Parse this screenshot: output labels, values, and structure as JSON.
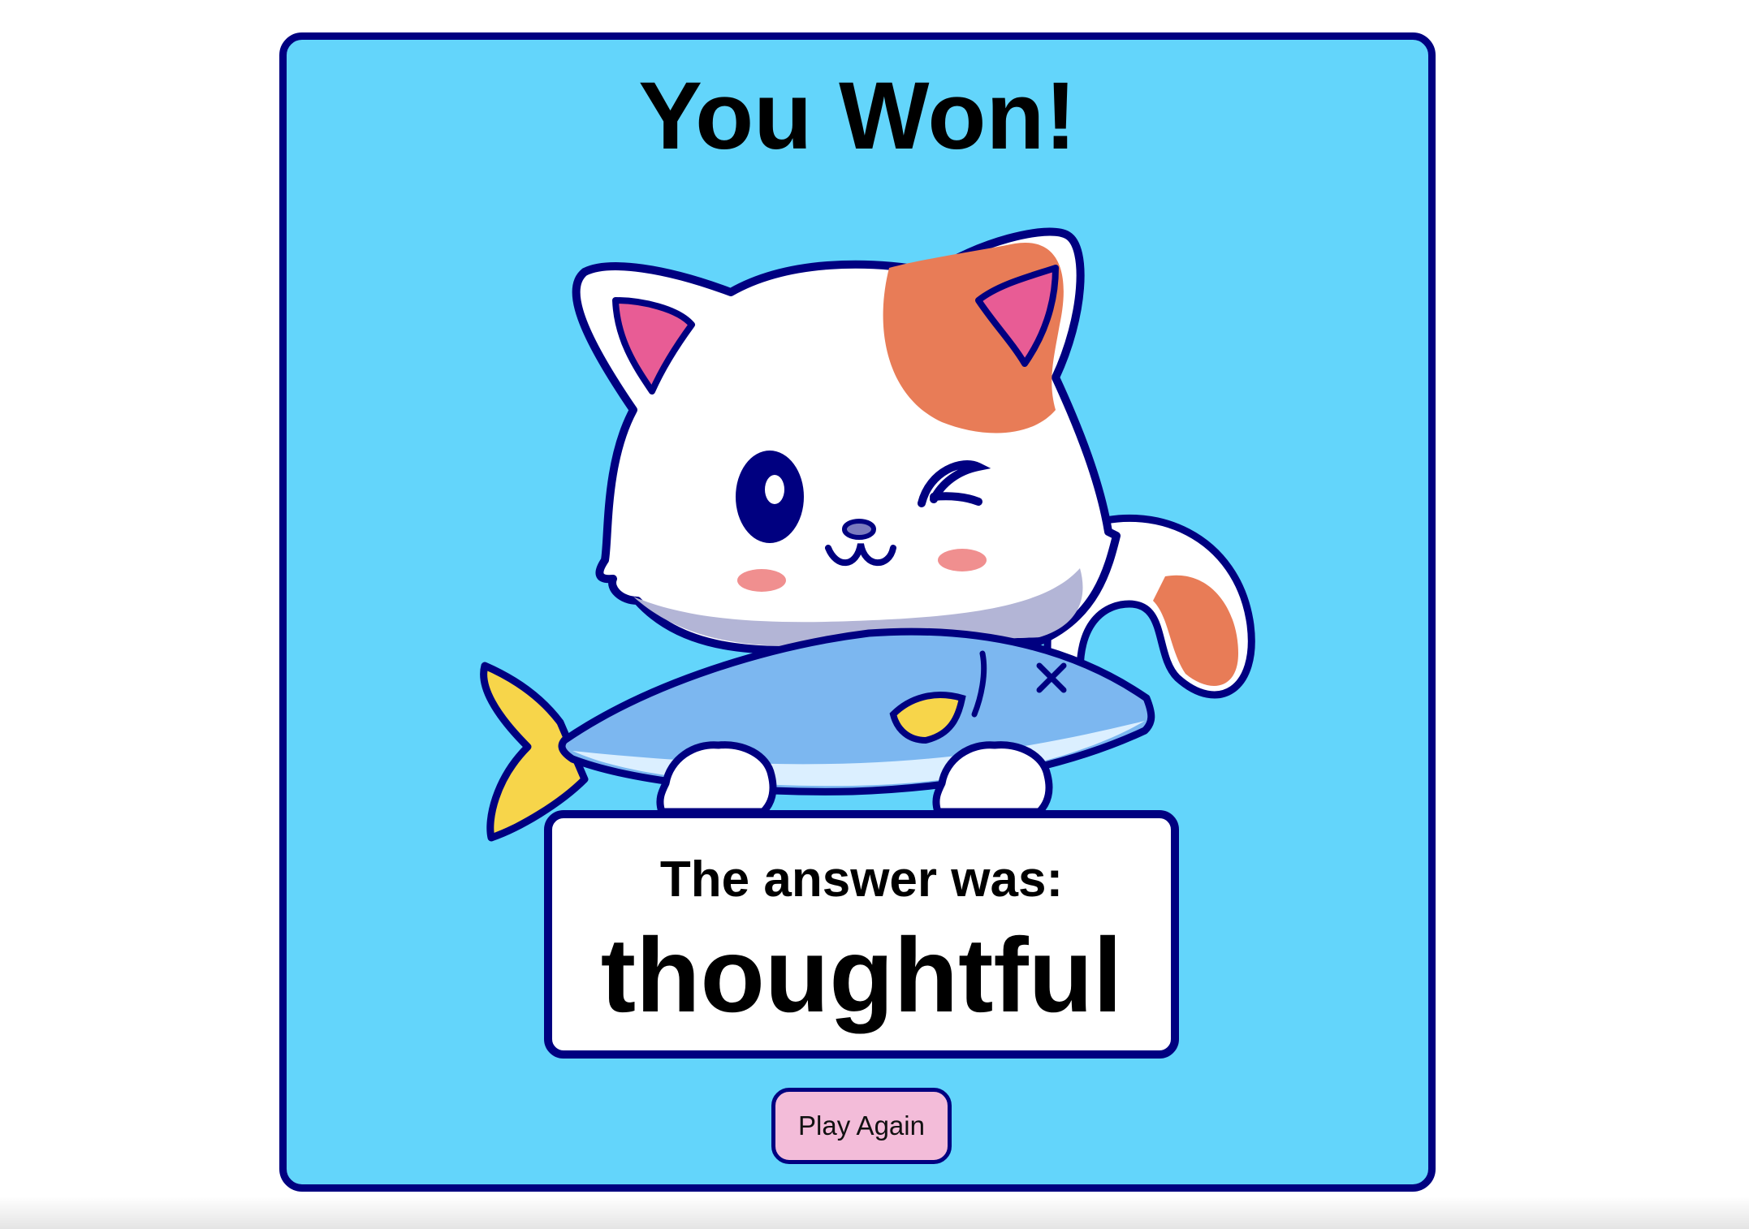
{
  "game": {
    "title": "You Won!",
    "answer_label": "The answer was:",
    "answer_word": "thoughtful",
    "play_again_label": "Play Again"
  },
  "illustration": {
    "subject": "cat-holding-fish-icon",
    "facial_expression": "winking"
  },
  "colors": {
    "card_background": "#63d5fb",
    "card_border": "#000080",
    "answer_box_background": "#ffffff",
    "button_background": "#f3bcd9",
    "cat_patch": "#e87c57",
    "fish_body": "#7cb7f0",
    "fish_fin": "#f7d54a",
    "ear_inner": "#e85c95"
  }
}
